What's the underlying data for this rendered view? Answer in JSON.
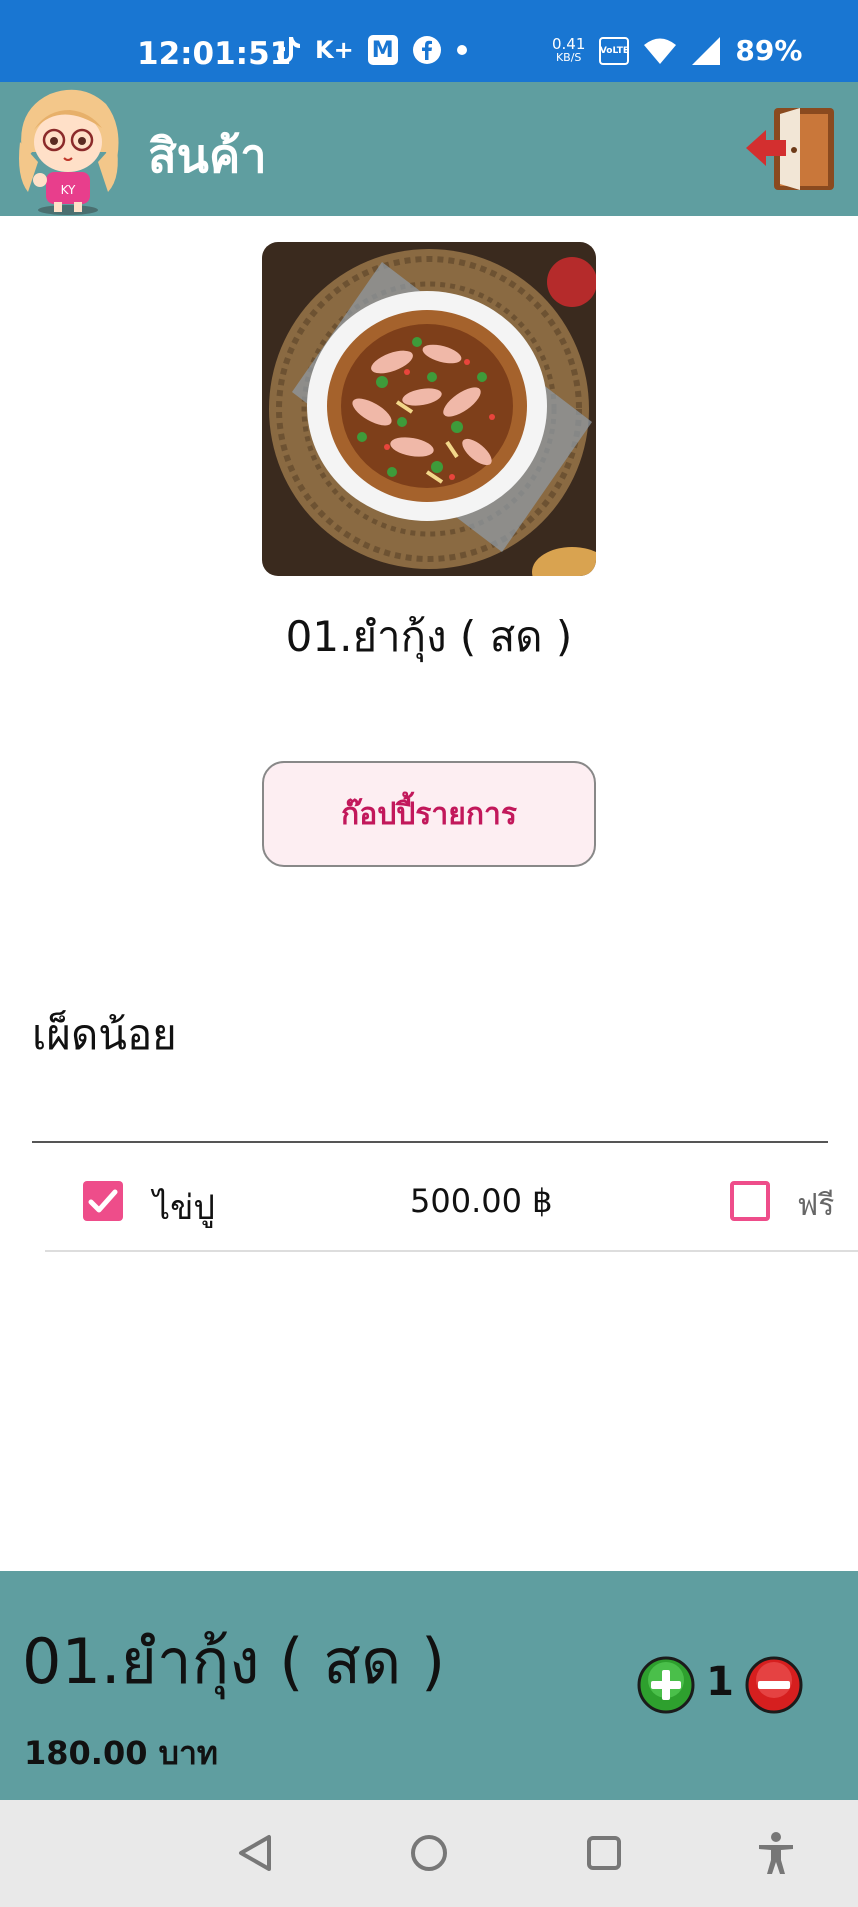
{
  "status_bar": {
    "time": "12:01:51",
    "icons": [
      "tiktok-icon",
      "k-plus-icon",
      "m-icon",
      "facebook-icon",
      "dot-icon"
    ],
    "k_plus_label": "K+",
    "m_label": "M",
    "network_speed_value": "0.41",
    "network_speed_unit": "KB/S",
    "volte_label": "VoLTE",
    "battery": "89%",
    "background": "#1976d2"
  },
  "header": {
    "title": "สินค้า",
    "avatar_icon": "cartoon-girl-avatar",
    "exit_icon": "exit-door-icon",
    "background": "#5f9ea0"
  },
  "product": {
    "image_icon": "shrimp-salad-photo",
    "name": "01.ยำกุ้ง ( สด )"
  },
  "copy_button": {
    "label": "ก๊อปปี้รายการ"
  },
  "note": "เผ็ดน้อย",
  "options": [
    {
      "name": "ไข่ปู",
      "price": "500.00 ฿",
      "selected": true,
      "free_label": "ฟรี",
      "free_selected": false
    }
  ],
  "summary": {
    "name": "01.ยำกุ้ง ( สด )",
    "price": "180.00 บาท",
    "quantity": "1",
    "plus_icon": "plus-circle-icon",
    "minus_icon": "minus-circle-icon"
  },
  "nav_bar": {
    "buttons": [
      "back-icon",
      "home-icon",
      "recents-icon",
      "accessibility-icon"
    ]
  },
  "colors": {
    "accent_pink": "#ee4d8a",
    "copy_text": "#c2185b",
    "teal": "#5f9ea0"
  }
}
